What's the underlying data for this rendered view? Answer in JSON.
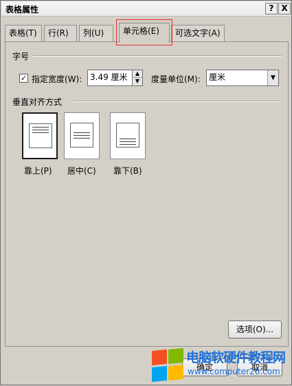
{
  "dialog": {
    "title": "表格属性",
    "help_button": "?",
    "close_button": "X"
  },
  "tabs": [
    {
      "label": "表格(T)"
    },
    {
      "label": "行(R)"
    },
    {
      "label": "列(U)"
    },
    {
      "label": "单元格(E)",
      "active": true
    },
    {
      "label": "可选文字(A)"
    }
  ],
  "size_section": {
    "heading": "字号",
    "checkbox_checked": true,
    "checkbox_mark": "✓",
    "width_label": "指定宽度(W):",
    "width_value": "3.49 厘米",
    "unit_label": "度量单位(M):",
    "unit_value": "厘米"
  },
  "valign_section": {
    "heading": "垂直对齐方式",
    "options": [
      {
        "label": "靠上(P)",
        "selected": true
      },
      {
        "label": "居中(C)",
        "selected": false
      },
      {
        "label": "靠下(B)",
        "selected": false
      }
    ]
  },
  "buttons": {
    "options": "选项(O)...",
    "ok": "确定",
    "cancel": "取消"
  },
  "watermark": {
    "title": "电脑软硬件教程网",
    "url": "www.computer26.com",
    "colors": {
      "red": "#f25022",
      "green": "#7fba00",
      "blue": "#00a4ef",
      "yellow": "#ffb900",
      "text": "#1f6fd8"
    }
  },
  "highlight_color": "#e03030"
}
